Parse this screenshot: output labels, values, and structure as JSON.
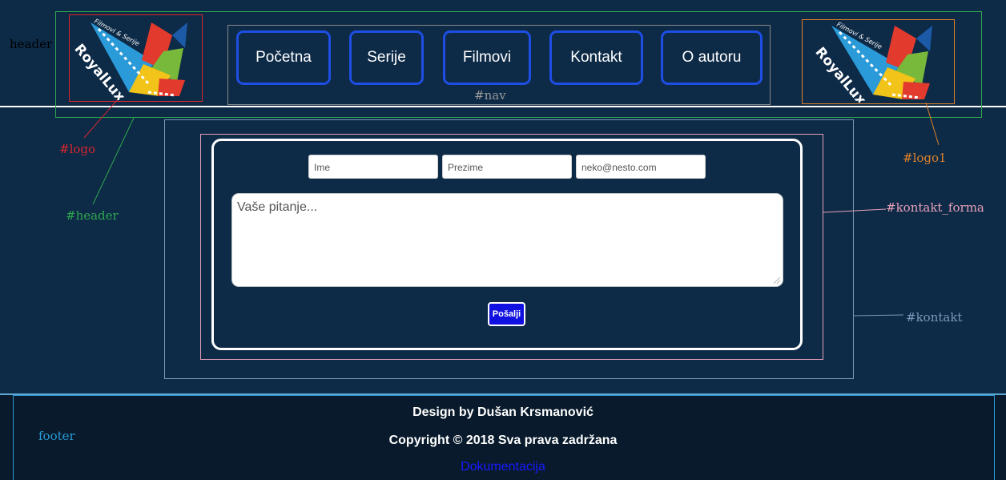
{
  "debug_labels": {
    "header_top": "header",
    "logo": "#logo",
    "header": "#header",
    "nav": "#nav",
    "logo1": "#logo1",
    "kontakt_forma": "#kontakt_forma",
    "kontakt": "#kontakt",
    "footer": "footer"
  },
  "logo": {
    "brand": "RoyalLux",
    "tagline": "Filmovi & Serije"
  },
  "nav": {
    "items": [
      {
        "label": "Početna"
      },
      {
        "label": "Serije"
      },
      {
        "label": "Filmovi"
      },
      {
        "label": "Kontakt"
      },
      {
        "label": "O autoru"
      }
    ]
  },
  "form": {
    "first_name_placeholder": "Ime",
    "last_name_placeholder": "Prezime",
    "email_placeholder": "neko@nesto.com",
    "question_placeholder": "Vaše pitanje...",
    "submit_label": "Pošalji"
  },
  "footer": {
    "design": "Design by Dušan Krsmanović",
    "copyright": "Copyright © 2018 Sva prava zadržana",
    "docs_link": "Dokumentacija"
  },
  "colors": {
    "background": "#0d2a47",
    "footer_background": "#081a2b",
    "nav_border": "#1e4ee3",
    "submit_button": "#1010e0",
    "debug_logo": "#d9262e",
    "debug_header": "#2fa84f",
    "debug_nav": "#9a9a9a",
    "debug_logo1": "#e0822a",
    "debug_kontakt_forma": "#e8a0b8",
    "debug_kontakt": "#7c97b8",
    "debug_footer": "#2a9bd8"
  }
}
